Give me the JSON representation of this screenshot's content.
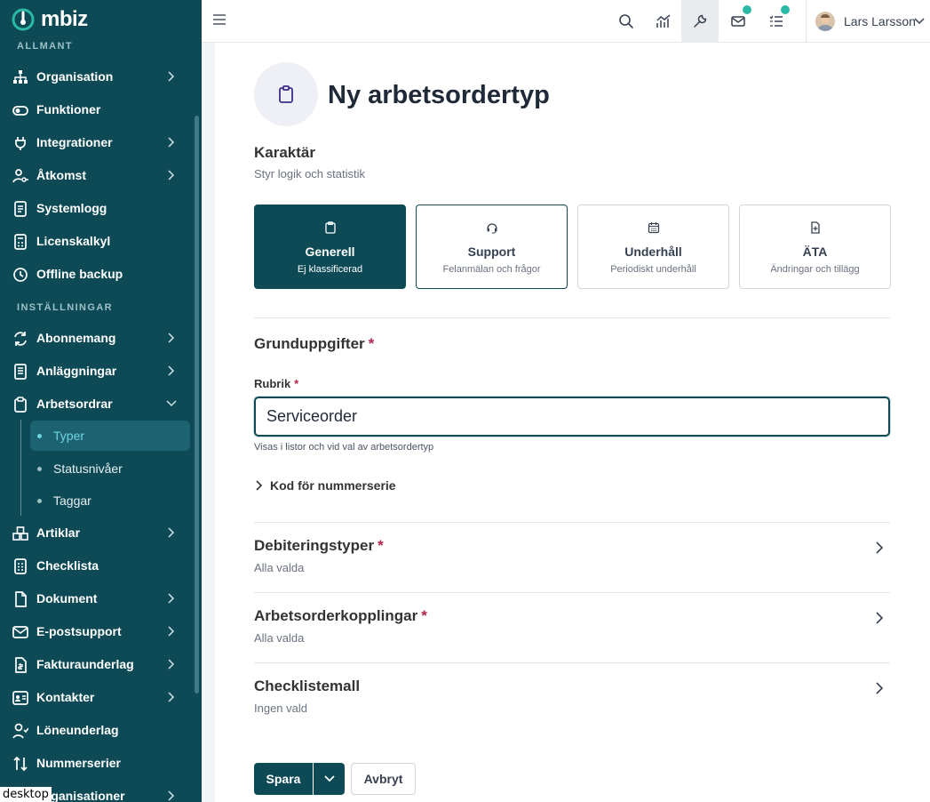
{
  "app": {
    "brand": "mbiz",
    "accent": "#0d4a56",
    "badge_color": "#2bb9a6"
  },
  "sidebar": {
    "section_general": "ALLMANT",
    "section_settings": "INSTÄLLNINGAR",
    "items_general": [
      {
        "label": "Organisation",
        "icon": "hierarchy-icon",
        "has_chevron": true
      },
      {
        "label": "Funktioner",
        "icon": "toggle-icon",
        "has_chevron": false
      },
      {
        "label": "Integrationer",
        "icon": "plug-icon",
        "has_chevron": true
      },
      {
        "label": "Åtkomst",
        "icon": "user-key-icon",
        "has_chevron": true
      },
      {
        "label": "Systemlogg",
        "icon": "log-icon",
        "has_chevron": false
      },
      {
        "label": "Licenskalkyl",
        "icon": "calculator-icon",
        "has_chevron": false
      },
      {
        "label": "Offline backup",
        "icon": "cloud-backup-icon",
        "has_chevron": false
      }
    ],
    "items_settings": [
      {
        "label": "Abonnemang",
        "icon": "refresh-icon",
        "has_chevron": true
      },
      {
        "label": "Anläggningar",
        "icon": "building-icon",
        "has_chevron": true
      },
      {
        "label": "Arbetsordrar",
        "icon": "clipboard-icon",
        "has_chevron": true,
        "expanded": true
      }
    ],
    "sub_items": [
      {
        "label": "Typer",
        "active": true
      },
      {
        "label": "Statusnivåer",
        "active": false
      },
      {
        "label": "Taggar",
        "active": false
      }
    ],
    "items_rest": [
      {
        "label": "Artiklar",
        "icon": "boxes-icon",
        "has_chevron": true
      },
      {
        "label": "Checklista",
        "icon": "checklist-icon",
        "has_chevron": false
      },
      {
        "label": "Dokument",
        "icon": "document-icon",
        "has_chevron": true
      },
      {
        "label": "E-postsupport",
        "icon": "mail-icon",
        "has_chevron": true
      },
      {
        "label": "Fakturaunderlag",
        "icon": "invoice-icon",
        "has_chevron": true
      },
      {
        "label": "Kontakter",
        "icon": "contact-card-icon",
        "has_chevron": true
      },
      {
        "label": "Löneunderlag",
        "icon": "payroll-icon",
        "has_chevron": false
      },
      {
        "label": "Nummerserier",
        "icon": "sort-icon",
        "has_chevron": false
      },
      {
        "label": "Organisationer",
        "icon": "organisations-icon",
        "has_chevron": true
      }
    ],
    "viewport_label": "desktop"
  },
  "topbar": {
    "user_name": "Lars Larsson",
    "buttons": [
      "search-icon",
      "chart-icon",
      "wrench-icon",
      "mail-icon",
      "tasks-icon"
    ]
  },
  "page": {
    "title": "Ny arbetsordertyp",
    "character": {
      "heading": "Karaktär",
      "subtitle": "Styr logik och statistik",
      "options": [
        {
          "title": "Generell",
          "subtitle": "Ej klassificerad",
          "icon": "clipboard-icon",
          "selected": true
        },
        {
          "title": "Support",
          "subtitle": "Felanmälan och frågor",
          "icon": "headset-icon",
          "selected": false
        },
        {
          "title": "Underhåll",
          "subtitle": "Periodiskt underhåll",
          "icon": "calendar-icon",
          "selected": false
        },
        {
          "title": "ÄTA",
          "subtitle": "Ändringar och tillägg",
          "icon": "file-plus-icon",
          "selected": false
        }
      ]
    },
    "basics": {
      "heading": "Grunduppgifter",
      "required_mark": "*",
      "field_label": "Rubrik",
      "field_value": "Serviceorder",
      "field_help": "Visas i listor och vid val av arbetsordertyp",
      "expander_label": "Kod för nummerserie"
    },
    "sections": [
      {
        "title": "Debiteringstyper",
        "required": true,
        "subtitle": "Alla valda"
      },
      {
        "title": "Arbetsorderkopplingar",
        "required": true,
        "subtitle": "Alla valda"
      },
      {
        "title": "Checklistemall",
        "required": false,
        "subtitle": "Ingen vald"
      }
    ],
    "actions": {
      "save": "Spara",
      "cancel": "Avbryt"
    }
  }
}
